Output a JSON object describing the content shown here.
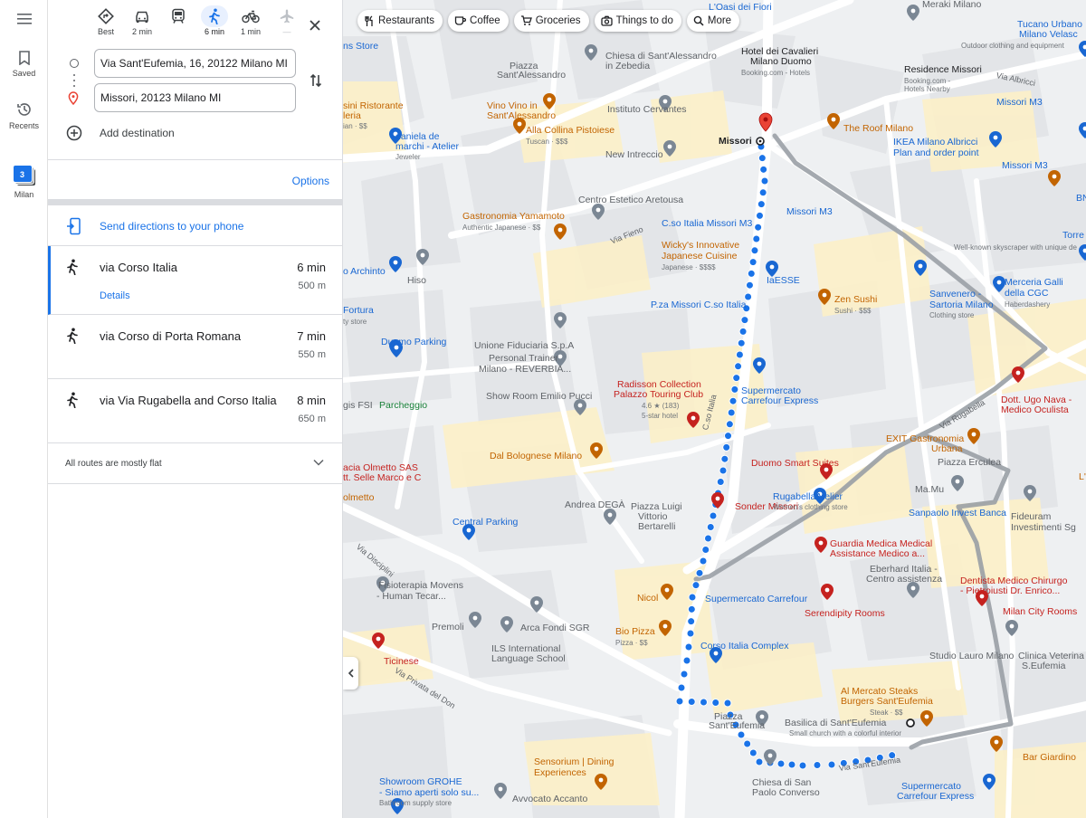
{
  "rail": {
    "saved": "Saved",
    "recents": "Recents",
    "milan": "Milan",
    "milan_badge": "3"
  },
  "modes": [
    {
      "label": "Best",
      "icon": "diamond-turn-icon"
    },
    {
      "label": "2 min",
      "icon": "car-icon"
    },
    {
      "label": "",
      "icon": "transit-icon"
    },
    {
      "label": "6 min",
      "icon": "walk-icon",
      "active": true
    },
    {
      "label": "1 min",
      "icon": "bike-icon"
    },
    {
      "label": "—",
      "icon": "flight-icon"
    }
  ],
  "directions": {
    "origin": "Via Sant'Eufemia, 16, 20122 Milano MI",
    "destination": "Missori, 20123 Milano MI",
    "add_destination": "Add destination",
    "options": "Options",
    "send_to_phone": "Send directions to your phone",
    "routes": [
      {
        "name": "via Corso Italia",
        "time": "6 min",
        "distance": "500 m",
        "details": "Details",
        "selected": true
      },
      {
        "name": "via Corso di Porta Romana",
        "time": "7 min",
        "distance": "550 m"
      },
      {
        "name": "via Via Rugabella and Corso Italia",
        "time": "8 min",
        "distance": "650 m"
      }
    ],
    "flat_note": "All routes are mostly flat"
  },
  "chips": [
    "Restaurants",
    "Coffee",
    "Groceries",
    "Things to do",
    "More"
  ],
  "colors": {
    "accent": "#1a73e8",
    "route_walk": "#1a73e8",
    "route_alt": "#9aa0a6",
    "map_block": "#e8eaed",
    "map_highlight": "#fdf3d2",
    "destination_pin": "#ea4335"
  },
  "map": {
    "places": [
      {
        "name": "L'Oasi dei Fiori",
        "kind": "shop"
      },
      {
        "name": "Meraki Milano",
        "kind": "gray"
      },
      {
        "name": "Tucano Urbano",
        "kind": "shop"
      },
      {
        "name": "Milano Velasc",
        "kind": "shop"
      },
      {
        "name": "Outdoor clothing and equipment",
        "kind": "sub"
      },
      {
        "name": "ns Store",
        "kind": "shop"
      },
      {
        "name": "Chiesa di Sant'Alessandro",
        "kind": "gray"
      },
      {
        "name": "in Zebedia",
        "kind": "gray"
      },
      {
        "name": "Piazza",
        "kind": "gray"
      },
      {
        "name": "Sant'Alessandro",
        "kind": "gray"
      },
      {
        "name": "Hotel dei Cavalieri",
        "kind": "dark-plain"
      },
      {
        "name": "Milano Duomo",
        "kind": "dark-plain"
      },
      {
        "name": "Booking.com - Hotels",
        "kind": "sub"
      },
      {
        "name": "Residence Missori",
        "kind": "dark-plain"
      },
      {
        "name": "Booking.com -",
        "kind": "sub"
      },
      {
        "name": "Hotels Nearby",
        "kind": "sub"
      },
      {
        "name": "Missori M3",
        "kind": "shop"
      },
      {
        "name": "sini Ristorante",
        "kind": "food"
      },
      {
        "name": "leria",
        "kind": "food"
      },
      {
        "name": "ian · $$",
        "kind": "sub"
      },
      {
        "name": "Vino Vino in",
        "kind": "food"
      },
      {
        "name": "Sant'Alessandro",
        "kind": "food"
      },
      {
        "name": "Instituto Cervantes",
        "kind": "gray"
      },
      {
        "name": "The Roof Milano",
        "kind": "food"
      },
      {
        "name": "daniela de",
        "kind": "shop"
      },
      {
        "name": "marchi - Atelier",
        "kind": "shop"
      },
      {
        "name": "Jeweler",
        "kind": "sub"
      },
      {
        "name": "Alla Collina Pistoiese",
        "kind": "food"
      },
      {
        "name": "Tuscan · $$$",
        "kind": "sub"
      },
      {
        "name": "Missori",
        "kind": "dark"
      },
      {
        "name": "IKEA Milano Albricci",
        "kind": "shop"
      },
      {
        "name": "Plan and order point",
        "kind": "shop"
      },
      {
        "name": "New Intreccio",
        "kind": "gray"
      },
      {
        "name": "Missori M3",
        "kind": "shop"
      },
      {
        "name": "BNL",
        "kind": "shop"
      },
      {
        "name": "Centro Estetico Aretousa",
        "kind": "gray"
      },
      {
        "name": "Missori M3",
        "kind": "shop"
      },
      {
        "name": "Gastronomia Yamamoto",
        "kind": "food"
      },
      {
        "name": "Authentic Japanese · $$",
        "kind": "sub"
      },
      {
        "name": "C.so Italia Missori M3",
        "kind": "shop"
      },
      {
        "name": "Torre Vela",
        "kind": "shop"
      },
      {
        "name": "Well-known skyscraper with unique de",
        "kind": "sub"
      },
      {
        "name": "Wicky's Innovative",
        "kind": "food"
      },
      {
        "name": "Japanese Cuisine",
        "kind": "food"
      },
      {
        "name": "Japanese · $$$$",
        "kind": "sub"
      },
      {
        "name": "o Archinto",
        "kind": "shop"
      },
      {
        "name": "Hiso",
        "kind": "gray"
      },
      {
        "name": "IaESSE",
        "kind": "shop"
      },
      {
        "name": "Zen Sushi",
        "kind": "food"
      },
      {
        "name": "Sushi · $$$",
        "kind": "sub"
      },
      {
        "name": "Sanvenero -",
        "kind": "shop"
      },
      {
        "name": "Sartoria Milano",
        "kind": "shop"
      },
      {
        "name": "Clothing store",
        "kind": "sub"
      },
      {
        "name": "Merceria Galli",
        "kind": "shop"
      },
      {
        "name": "della CGC",
        "kind": "shop"
      },
      {
        "name": "Haberdashery",
        "kind": "sub"
      },
      {
        "name": "Fortura",
        "kind": "shop"
      },
      {
        "name": "ty store",
        "kind": "sub"
      },
      {
        "name": "P.za Missori C.so Italia",
        "kind": "shop"
      },
      {
        "name": "Duomo Parking",
        "kind": "shop"
      },
      {
        "name": "Unione Fiduciaria S.p.A",
        "kind": "gray"
      },
      {
        "name": "Personal Trainer",
        "kind": "gray"
      },
      {
        "name": "Milano - REVERBIA...",
        "kind": "gray"
      },
      {
        "name": "Radisson Collection",
        "kind": "lodge"
      },
      {
        "name": "Palazzo Touring Club",
        "kind": "lodge"
      },
      {
        "name": "4.6 ★ (183)",
        "kind": "sub"
      },
      {
        "name": "5-star hotel",
        "kind": "sub"
      },
      {
        "name": "Supermercato",
        "kind": "shop"
      },
      {
        "name": "Carrefour Express",
        "kind": "shop"
      },
      {
        "name": "Dott. Ugo Nava -",
        "kind": "lodge"
      },
      {
        "name": "Medico Oculista",
        "kind": "lodge"
      },
      {
        "name": "gis FSI",
        "kind": "gray"
      },
      {
        "name": "Parcheggio",
        "kind": "green"
      },
      {
        "name": "Show Room Emilio Pucci",
        "kind": "gray"
      },
      {
        "name": "EXIT Gastronomia",
        "kind": "food"
      },
      {
        "name": "Urbana",
        "kind": "food"
      },
      {
        "name": "Dal Bolognese Milano",
        "kind": "food"
      },
      {
        "name": "Duomo Smart Suites",
        "kind": "lodge"
      },
      {
        "name": "Piazza Erculea",
        "kind": "gray"
      },
      {
        "name": "acia Olmetto SAS",
        "kind": "lodge"
      },
      {
        "name": "tt. Selle Marco e C",
        "kind": "lodge"
      },
      {
        "name": "L'Isola del",
        "kind": "food"
      },
      {
        "name": "Ma.Mu",
        "kind": "gray"
      },
      {
        "name": "olmetto",
        "kind": "food"
      },
      {
        "name": "Andrea DEGÀ",
        "kind": "gray"
      },
      {
        "name": "Piazza Luigi",
        "kind": "gray"
      },
      {
        "name": "Vittorio",
        "kind": "gray"
      },
      {
        "name": "Bertarelli",
        "kind": "gray"
      },
      {
        "name": "Sonder Missori",
        "kind": "lodge"
      },
      {
        "name": "RugabellaAtelier",
        "kind": "shop"
      },
      {
        "name": "Women's clothing store",
        "kind": "sub"
      },
      {
        "name": "Sanpaolo Invest Banca",
        "kind": "shop"
      },
      {
        "name": "Fideuram",
        "kind": "gray"
      },
      {
        "name": "Investimenti Sg",
        "kind": "gray"
      },
      {
        "name": "Central Parking",
        "kind": "shop"
      },
      {
        "name": "Guardia Medica Medical",
        "kind": "lodge"
      },
      {
        "name": "Assistance Medico a...",
        "kind": "lodge"
      },
      {
        "name": "Eberhard Italia -",
        "kind": "gray"
      },
      {
        "name": "Centro assistenza",
        "kind": "gray"
      },
      {
        "name": "Dentista Medico Chirurgo",
        "kind": "lodge"
      },
      {
        "name": "- Pietroiusti Dr. Enrico...",
        "kind": "lodge"
      },
      {
        "name": "Fisioterapia Movens",
        "kind": "gray"
      },
      {
        "name": "- Human Tecar...",
        "kind": "gray"
      },
      {
        "name": "Supermercato Carrefour",
        "kind": "shop"
      },
      {
        "name": "Nicol",
        "kind": "food"
      },
      {
        "name": "Serendipity Rooms",
        "kind": "lodge"
      },
      {
        "name": "Milan City Rooms",
        "kind": "lodge"
      },
      {
        "name": "Premoli",
        "kind": "gray"
      },
      {
        "name": "Arca Fondi SGR",
        "kind": "gray"
      },
      {
        "name": "Bio Pizza",
        "kind": "food"
      },
      {
        "name": "Pizza · $$",
        "kind": "sub"
      },
      {
        "name": "Corso Italia Complex",
        "kind": "shop"
      },
      {
        "name": "Studio Lauro Milano",
        "kind": "gray"
      },
      {
        "name": "Clinica Veterina",
        "kind": "gray"
      },
      {
        "name": "S.Eufemia",
        "kind": "gray"
      },
      {
        "name": "ILS International",
        "kind": "gray"
      },
      {
        "name": "Language School",
        "kind": "gray"
      },
      {
        "name": "Ticinese",
        "kind": "lodge"
      },
      {
        "name": "Al Mercato Steaks",
        "kind": "food"
      },
      {
        "name": "Burgers Sant'Eufemia",
        "kind": "food"
      },
      {
        "name": "Steak · $$",
        "kind": "sub"
      },
      {
        "name": "Piazza",
        "kind": "gray"
      },
      {
        "name": "Sant'Eufemia",
        "kind": "gray"
      },
      {
        "name": "Basilica di Sant'Eufemia",
        "kind": "gray"
      },
      {
        "name": "Small church with a colorful interior",
        "kind": "sub"
      },
      {
        "name": "Bar Giardino",
        "kind": "food"
      },
      {
        "name": "Sensorium | Dining",
        "kind": "food"
      },
      {
        "name": "Experiences",
        "kind": "food"
      },
      {
        "name": "Chiesa di San",
        "kind": "gray"
      },
      {
        "name": "Paolo Converso",
        "kind": "gray"
      },
      {
        "name": "Supermercato",
        "kind": "shop"
      },
      {
        "name": "Carrefour Express",
        "kind": "shop"
      },
      {
        "name": "Showroom GROHE",
        "kind": "shop"
      },
      {
        "name": "- Siamo aperti solo su...",
        "kind": "shop"
      },
      {
        "name": "Bathroom supply store",
        "kind": "sub"
      },
      {
        "name": "Avvocato Accanto",
        "kind": "gray"
      }
    ],
    "roads": [
      "Via Fieno",
      "Via Albricci",
      "C.so Italia",
      "Via Rugabella",
      "Via Disciplini",
      "Via Privata del Don",
      "Via Sant'Eufemia"
    ]
  }
}
